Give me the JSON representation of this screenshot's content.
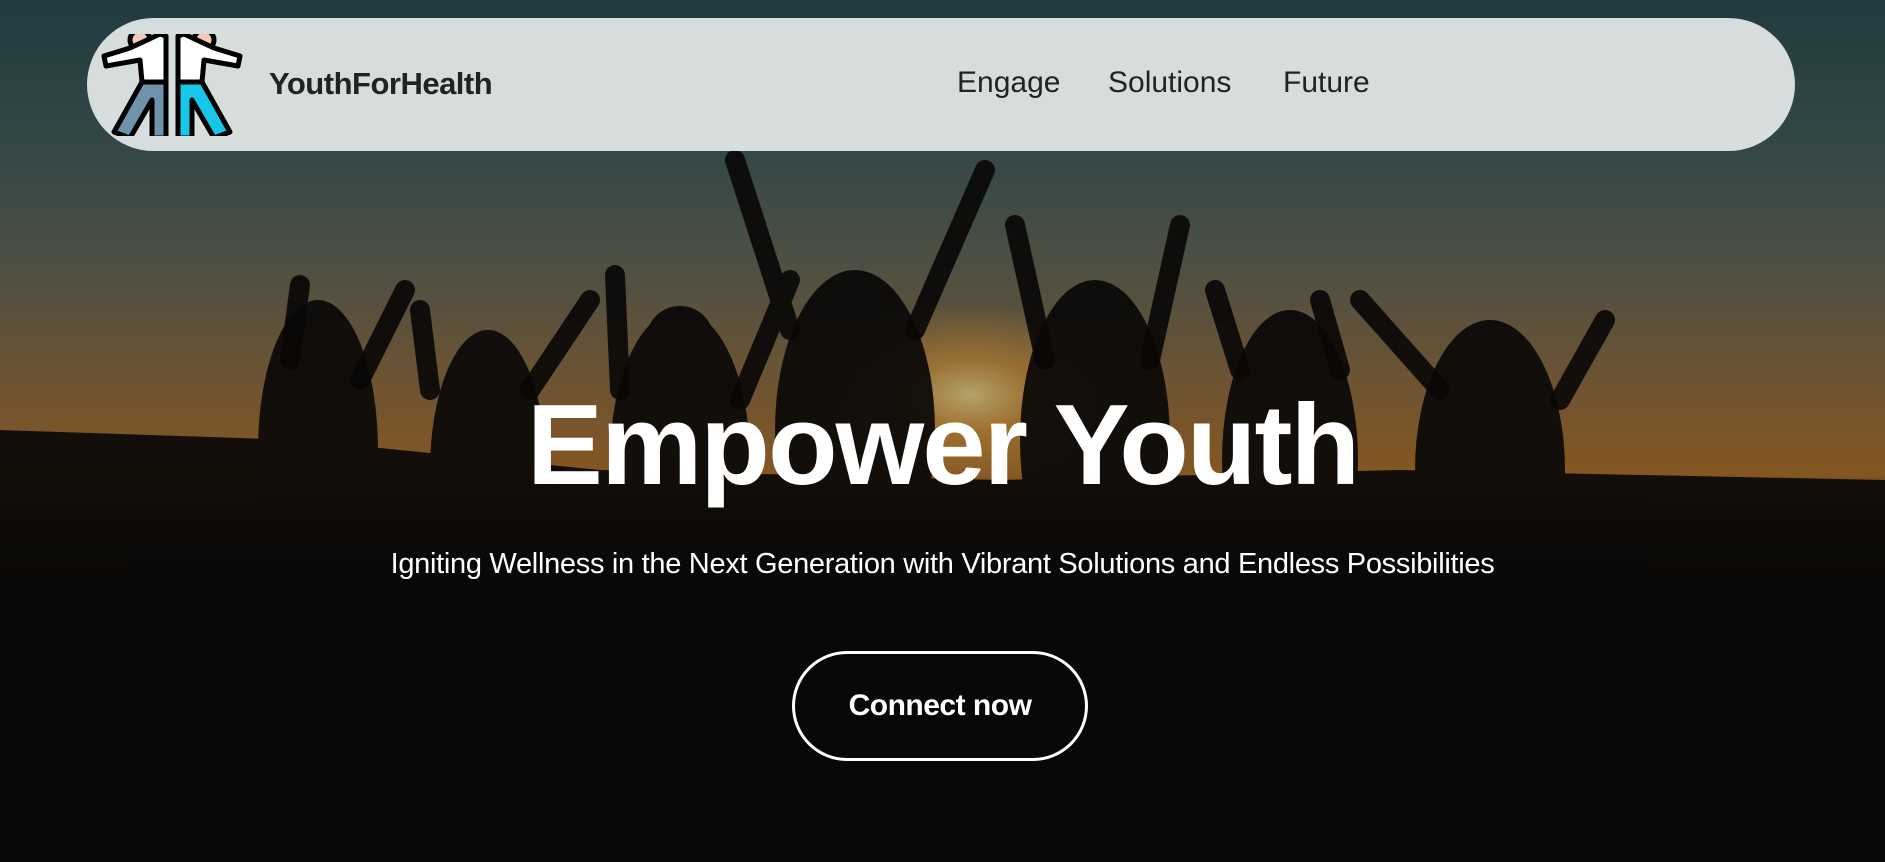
{
  "brand": {
    "name": "YouthForHealth",
    "logo_icon": "high-five-people-icon"
  },
  "nav": {
    "links": [
      {
        "label": "Engage"
      },
      {
        "label": "Solutions"
      },
      {
        "label": "Future"
      }
    ]
  },
  "hero": {
    "title": "Empower Youth",
    "subtitle": "Igniting Wellness in the Next Generation with Vibrant Solutions and Endless Possibilities",
    "cta_label": "Connect now",
    "background": "sunset-silhouettes-of-youth-raising-hands"
  },
  "colors": {
    "nav_bg": "#e6eaea",
    "text_dark": "#222222",
    "cta_border": "#ffffff"
  }
}
